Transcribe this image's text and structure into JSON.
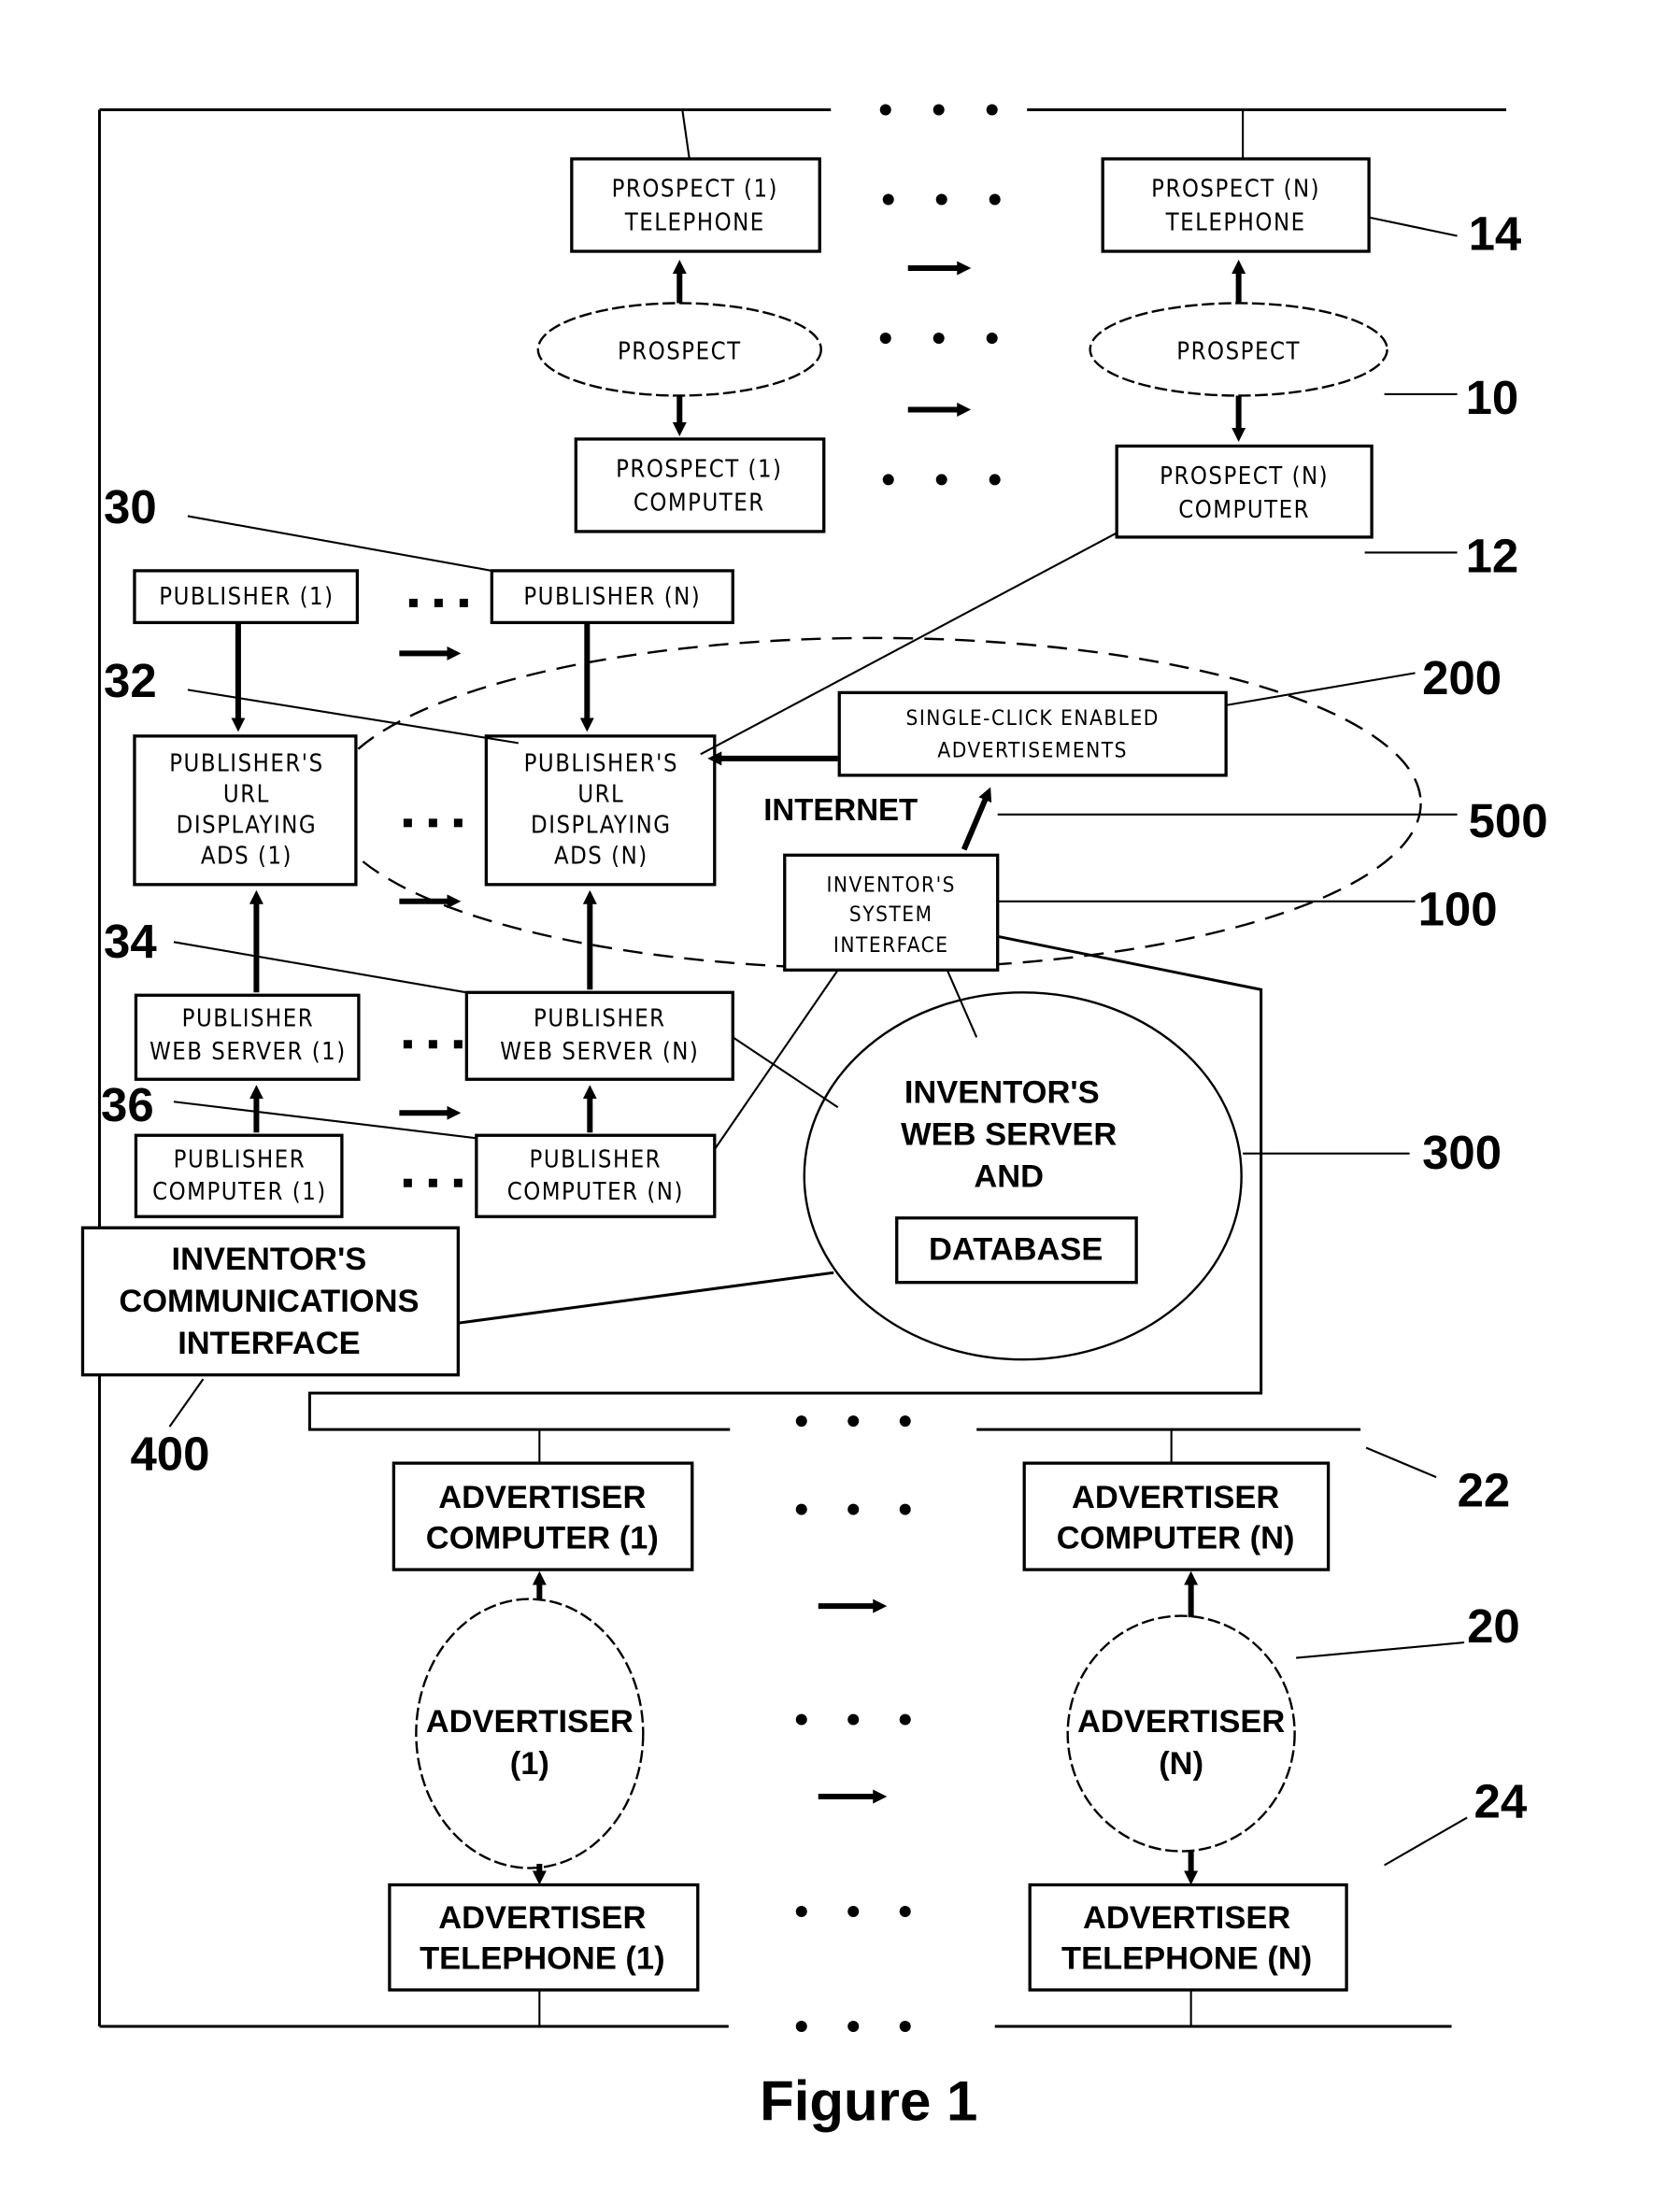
{
  "figure": {
    "caption": "Figure 1",
    "prospect_side": {
      "telephone_1": [
        "PROSPECT (1)",
        "TELEPHONE"
      ],
      "telephone_n": [
        "PROSPECT (N)",
        "TELEPHONE"
      ],
      "prospect_1": "PROSPECT",
      "prospect_n": "PROSPECT",
      "computer_1": [
        "PROSPECT (1)",
        "COMPUTER"
      ],
      "computer_n": [
        "PROSPECT (N)",
        "COMPUTER"
      ]
    },
    "publisher_side": {
      "publisher_1": "PUBLISHER (1)",
      "publisher_n": "PUBLISHER (N)",
      "url_1": [
        "PUBLISHER'S",
        "URL",
        "DISPLAYING",
        "ADS (1)"
      ],
      "url_n": [
        "PUBLISHER'S",
        "URL",
        "DISPLAYING",
        "ADS (N)"
      ],
      "web_server_1": [
        "PUBLISHER",
        "WEB SERVER (1)"
      ],
      "web_server_n": [
        "PUBLISHER",
        "WEB SERVER (N)"
      ],
      "computer_1": [
        "PUBLISHER",
        "COMPUTER (1)"
      ],
      "computer_n": [
        "PUBLISHER",
        "COMPUTER (N)"
      ]
    },
    "system": {
      "ads": [
        "SINGLE-CLICK ENABLED",
        "ADVERTISEMENTS"
      ],
      "internet": "INTERNET",
      "system_interface": [
        "INVENTOR'S",
        "SYSTEM",
        "INTERFACE"
      ],
      "web_server": [
        "INVENTOR'S",
        "WEB SERVER",
        "AND"
      ],
      "database": "DATABASE",
      "comm_interface": [
        "INVENTOR'S",
        "COMMUNICATIONS",
        "INTERFACE"
      ]
    },
    "advertiser_side": {
      "computer_1": [
        "ADVERTISER",
        "COMPUTER (1)"
      ],
      "computer_n": [
        "ADVERTISER",
        "COMPUTER (N)"
      ],
      "advertiser_1": [
        "ADVERTISER",
        "(1)"
      ],
      "advertiser_n": [
        "ADVERTISER",
        "(N)"
      ],
      "telephone_1": [
        "ADVERTISER",
        "TELEPHONE (1)"
      ],
      "telephone_n": [
        "ADVERTISER",
        "TELEPHONE (N)"
      ]
    },
    "reference_numerals": {
      "r14": "14",
      "r10": "10",
      "r12": "12",
      "r30": "30",
      "r32": "32",
      "r200": "200",
      "r500": "500",
      "r100": "100",
      "r34": "34",
      "r36": "36",
      "r300": "300",
      "r400": "400",
      "r22": "22",
      "r20": "20",
      "r24": "24"
    }
  }
}
